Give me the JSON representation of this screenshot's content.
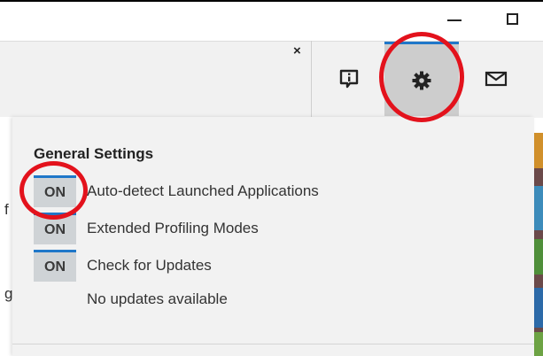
{
  "window": {
    "minimize_icon": "minimize-icon",
    "maximize_icon": "maximize-icon"
  },
  "header": {
    "close_glyph": "×",
    "info_icon": "info-comment-icon",
    "settings_icon": "gear-icon",
    "mail_icon": "mail-icon",
    "accent_color": "#1f77c9"
  },
  "left_fragments": [
    "f",
    "g"
  ],
  "general_settings": {
    "title": "General Settings",
    "toggles": [
      {
        "state": "ON",
        "label": "Auto-detect Launched Applications"
      },
      {
        "state": "ON",
        "label": "Extended Profiling Modes"
      },
      {
        "state": "ON",
        "label": "Check for Updates"
      }
    ],
    "update_status": "No updates available"
  },
  "annotation_color": "#e3121c"
}
